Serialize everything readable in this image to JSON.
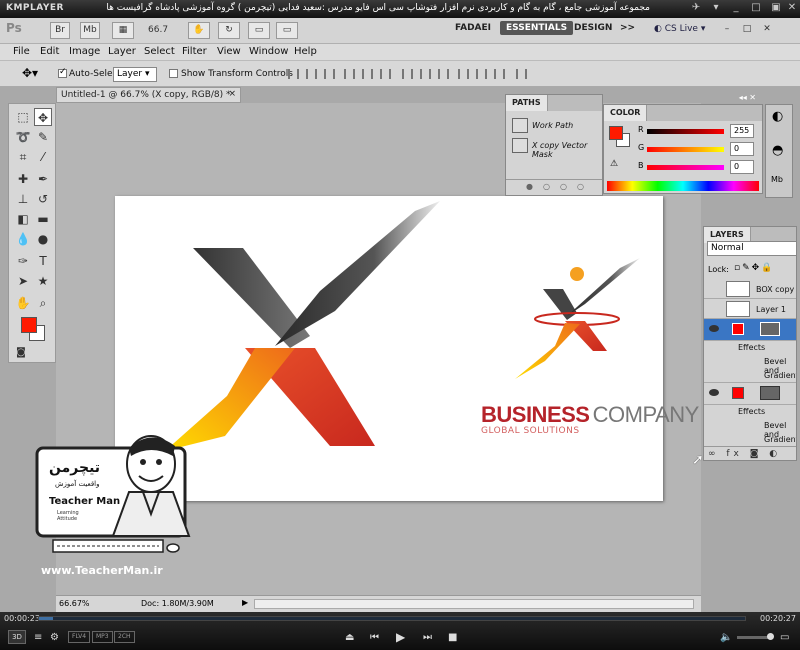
{
  "player": {
    "logo": "KMPLAYER",
    "caption": "مجموعه آموزشی جامع ، گام به گام و کاربردی نرم افزار فتوشاپ سی اس فایو  مدرس :سعید فدایی (تیچرمن ) گروه آموزشی پادشاه گرافیست ها",
    "time_elapsed": "00:00:23",
    "time_total": "00:20:27",
    "progress": 0.02,
    "badges": [
      "FLV4",
      "MP3",
      "2CH"
    ],
    "three_d": "3D"
  },
  "ps": {
    "logo": "Ps",
    "bridge_btn": "Br",
    "minibridge_btn": "Mb",
    "zoom": "66.7",
    "workspaces": [
      "FADAEI",
      "ESSENTIALS",
      "DESIGN"
    ],
    "more_ws": ">>",
    "cs_live": "CS Live"
  },
  "menu": [
    "File",
    "Edit",
    "Image",
    "Layer",
    "Select",
    "Filter",
    "View",
    "Window",
    "Help"
  ],
  "options": {
    "auto_select_label": "Auto-Select:",
    "auto_select_value": "Layer",
    "show_transform_label": "Show Transform Controls"
  },
  "document": {
    "tab_title": "Untitled-1 @ 66.7% (X copy, RGB/8) *",
    "close": "×",
    "zoom_status": "66.67%",
    "doc_status": "Doc: 1.80M/3.90M"
  },
  "logo": {
    "business": "BUSINESS",
    "company": "COMPANY",
    "tagline": "GLOBAL SOLUTIONS"
  },
  "paths_panel": {
    "tab": "PATHS",
    "items": [
      "Work Path",
      "X copy Vector Mask"
    ]
  },
  "color_panel": {
    "tab": "COLOR",
    "channels": [
      {
        "label": "R",
        "value": "255"
      },
      {
        "label": "G",
        "value": "0"
      },
      {
        "label": "B",
        "value": "0"
      }
    ],
    "fg_color": "#ff1a00"
  },
  "layers_panel": {
    "tab": "LAYERS",
    "blend_mode": "Normal",
    "lock_label": "Lock:",
    "layers": [
      {
        "name": "BOX copy"
      },
      {
        "name": "Layer 1"
      },
      {
        "name": "Effects"
      },
      {
        "name": "Bevel and"
      },
      {
        "name": "Gradient"
      },
      {
        "name": "Effects"
      },
      {
        "name": "Bevel and"
      },
      {
        "name": "Gradient"
      }
    ]
  },
  "teacherman": {
    "name": "Teacher Man",
    "site": "www.TeacherMan.ir",
    "persian": "تیچرمن",
    "persian_sub": "واقعیت آموزش",
    "learning": "Learning Attitude"
  }
}
